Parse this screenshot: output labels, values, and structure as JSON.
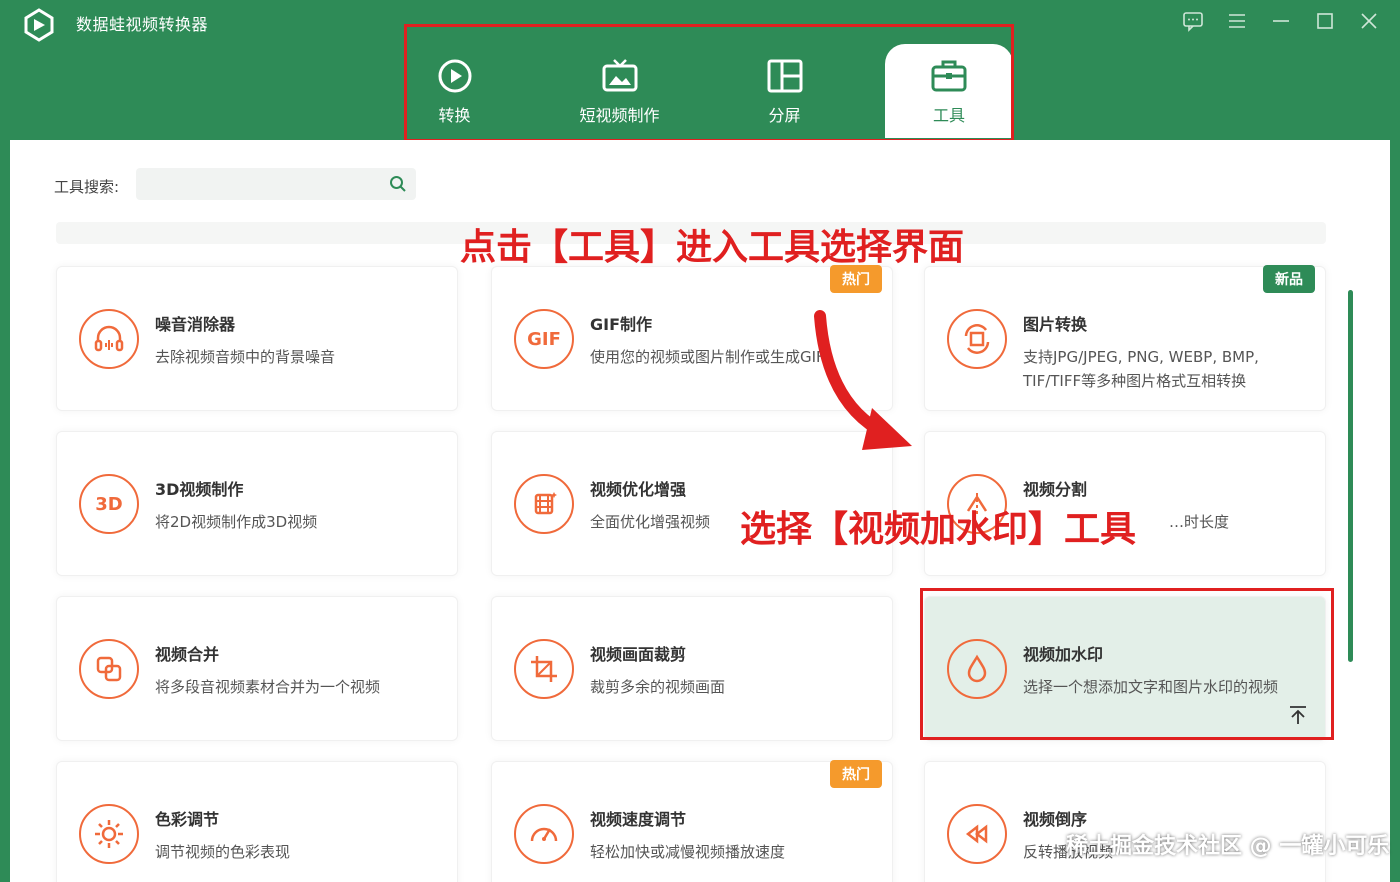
{
  "app": {
    "title": "数据蛙视频转换器"
  },
  "colors": {
    "brand": "#2e8b57",
    "accent": "#f06a3b",
    "annotation": "#e02020",
    "hot_badge": "#f59a2c"
  },
  "tabs": [
    {
      "label": "转换",
      "icon": "convert-icon"
    },
    {
      "label": "短视频制作",
      "icon": "tv-icon"
    },
    {
      "label": "分屏",
      "icon": "split-screen-icon"
    },
    {
      "label": "工具",
      "icon": "toolbox-icon",
      "active": true
    }
  ],
  "search": {
    "label": "工具搜索:",
    "placeholder": ""
  },
  "annotations": {
    "tools_tip": "点击【工具】进入工具选择界面",
    "watermark_tip": "选择【视频加水印】工具"
  },
  "cards": [
    {
      "title": "噪音消除器",
      "desc": "去除视频音频中的背景噪音",
      "icon": "headphones-icon"
    },
    {
      "title": "GIF制作",
      "desc": "使用您的视频或图片制作或生成GIF",
      "icon": "gif-icon",
      "icon_text": "GIF",
      "badge": "热门"
    },
    {
      "title": "图片转换",
      "desc": "支持JPG/JPEG, PNG, WEBP, BMP, TIF/TIFF等多种图片格式互相转换",
      "icon": "image-convert-icon",
      "badge": "新品"
    },
    {
      "title": "3D视频制作",
      "desc": "将2D视频制作成3D视频",
      "icon": "3d-icon",
      "icon_text": "3D"
    },
    {
      "title": "视频优化增强",
      "desc": "全面优化增强视频",
      "icon": "enhance-icon"
    },
    {
      "title": "视频分割",
      "desc": "…时长度",
      "icon": "split-icon"
    },
    {
      "title": "视频合并",
      "desc": "将多段音视频素材合并为一个视频",
      "icon": "merge-icon"
    },
    {
      "title": "视频画面裁剪",
      "desc": "裁剪多余的视频画面",
      "icon": "crop-icon"
    },
    {
      "title": "视频加水印",
      "desc": "选择一个想添加文字和图片水印的视频",
      "icon": "droplet-icon",
      "selected": true
    },
    {
      "title": "色彩调节",
      "desc": "调节视频的色彩表现",
      "icon": "color-icon"
    },
    {
      "title": "视频速度调节",
      "desc": "轻松加快或减慢视频播放速度",
      "icon": "speed-icon",
      "badge": "热门"
    },
    {
      "title": "视频倒序",
      "desc": "反转播放视频",
      "icon": "rewind-icon"
    }
  ],
  "watermark_text": "稀土掘金技术社区 @ 一罐小可乐"
}
